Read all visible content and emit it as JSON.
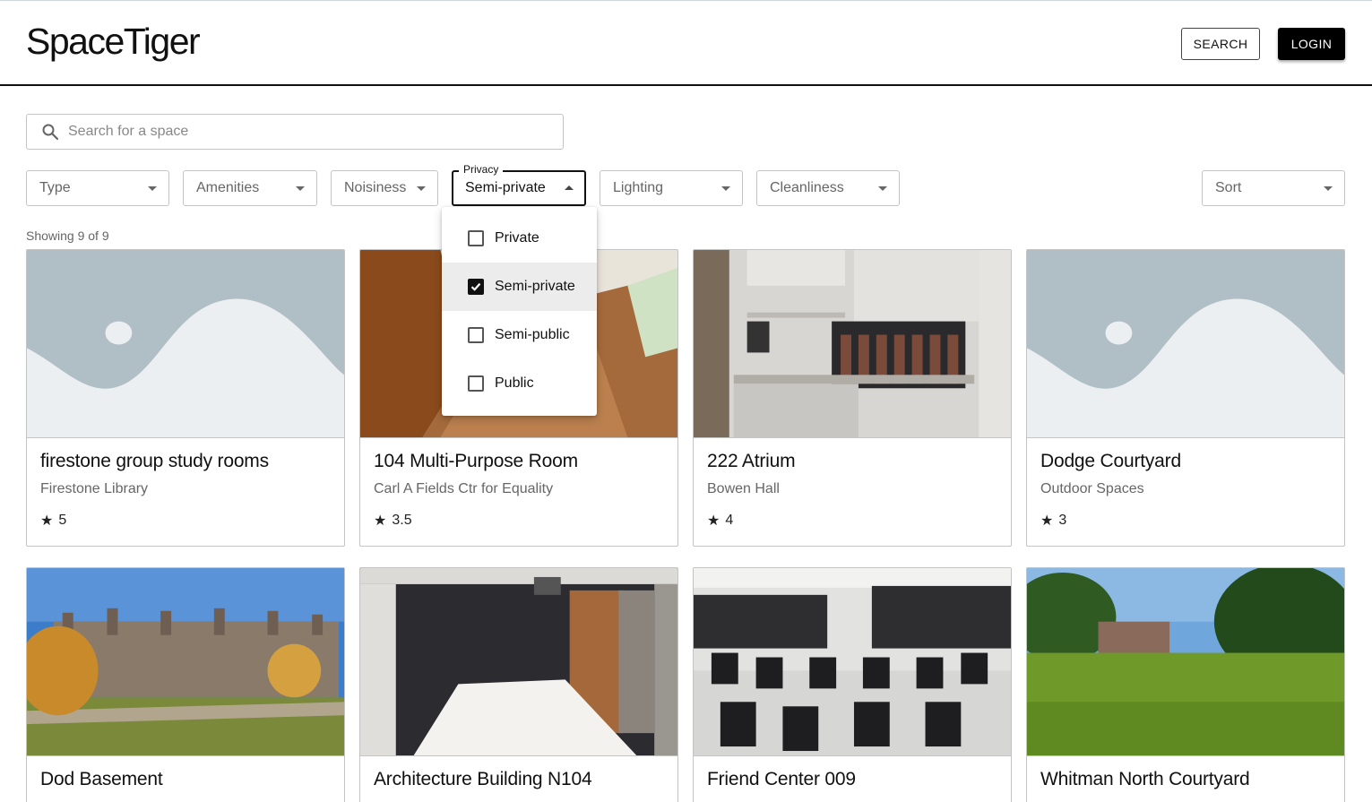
{
  "header": {
    "logo": "SpaceTiger",
    "search_button": "SEARCH",
    "login_button": "LOGIN"
  },
  "search": {
    "placeholder": "Search for a space",
    "icon": "search-icon"
  },
  "filters": {
    "type": "Type",
    "amenities": "Amenities",
    "noisiness": "Noisiness",
    "privacy_label": "Privacy",
    "privacy_value": "Semi-private",
    "lighting": "Lighting",
    "cleanliness": "Cleanliness",
    "sort": "Sort"
  },
  "privacy_menu": {
    "options": [
      {
        "label": "Private",
        "checked": false
      },
      {
        "label": "Semi-private",
        "checked": true
      },
      {
        "label": "Semi-public",
        "checked": false
      },
      {
        "label": "Public",
        "checked": false
      }
    ]
  },
  "results": {
    "showing": "Showing 9 of 9"
  },
  "cards": [
    {
      "title": "firestone group study rooms",
      "subtitle": "Firestone Library",
      "rating": "5",
      "image": "placeholder"
    },
    {
      "title": "104 Multi-Purpose Room",
      "subtitle": "Carl A Fields Ctr for Equality",
      "rating": "3.5",
      "image": "hallway"
    },
    {
      "title": "222 Atrium",
      "subtitle": "Bowen Hall",
      "rating": "4",
      "image": "kitchen"
    },
    {
      "title": "Dodge Courtyard",
      "subtitle": "Outdoor Spaces",
      "rating": "3",
      "image": "placeholder"
    },
    {
      "title": "Dod Basement",
      "image": "building"
    },
    {
      "title": "Architecture Building N104",
      "image": "room-table"
    },
    {
      "title": "Friend Center 009",
      "image": "classroom"
    },
    {
      "title": "Whitman North Courtyard",
      "image": "lawn"
    }
  ],
  "colors": {
    "accent": "#000000",
    "placeholder_bg": "#b0bec5",
    "placeholder_fg": "#eceff1"
  }
}
